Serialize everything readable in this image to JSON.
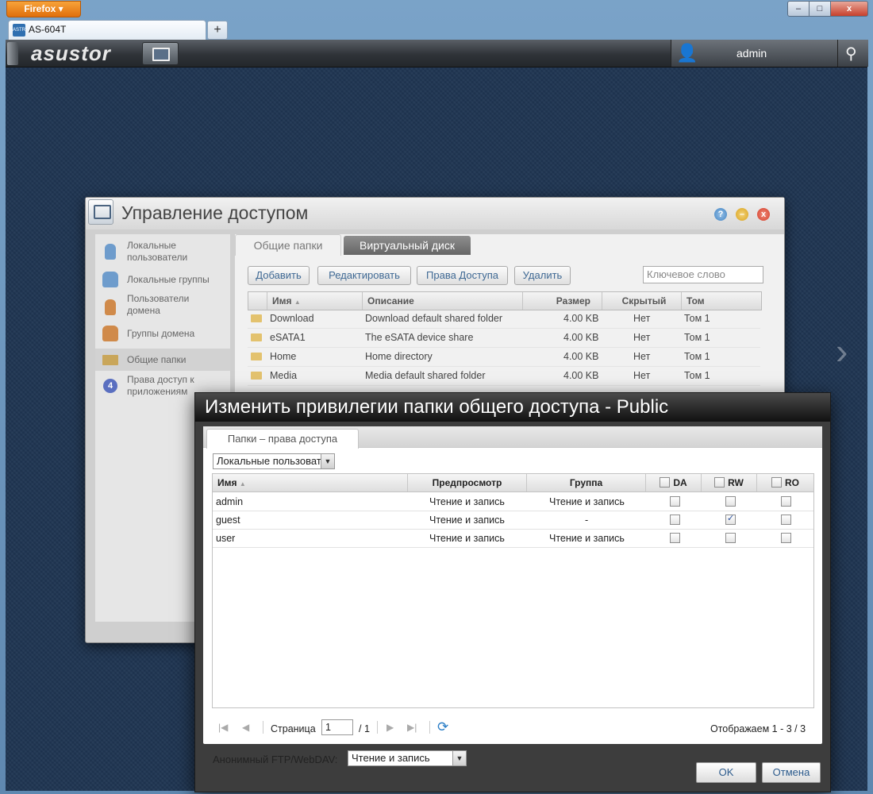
{
  "browser": {
    "menu_label": "Firefox",
    "tab_title": "AS-604T",
    "tab_icon_text": "ASTR",
    "new_tab_label": "+",
    "min_glyph": "–",
    "max_glyph": "□",
    "close_glyph": "x"
  },
  "topbar": {
    "logo": "asustor",
    "user": "admin"
  },
  "access_window": {
    "title": "Управление доступом",
    "help": "?",
    "minimize": "–",
    "close": "x",
    "sidebar": [
      {
        "label": "Локальные пользователи"
      },
      {
        "label": "Локальные группы"
      },
      {
        "label": "Пользователи домена"
      },
      {
        "label": "Группы домена"
      },
      {
        "label": "Общие папки"
      },
      {
        "label": "Права доступ к приложениям"
      }
    ],
    "tabs": [
      "Общие папки",
      "Виртуальный диск"
    ],
    "toolbar": {
      "add": "Добавить",
      "edit": "Редактировать",
      "access": "Права Доступа",
      "delete": "Удалить",
      "search_placeholder": "Ключевое слово"
    },
    "columns": [
      "Имя",
      "Описание",
      "Размер",
      "Скрытый",
      "Том"
    ],
    "rows": [
      {
        "name": "Download",
        "desc": "Download default shared folder",
        "size": "4.00 KB",
        "hidden": "Нет",
        "volume": "Том 1"
      },
      {
        "name": "eSATA1",
        "desc": "The eSATA device share",
        "size": "4.00 KB",
        "hidden": "Нет",
        "volume": "Том 1"
      },
      {
        "name": "Home",
        "desc": "Home directory",
        "size": "4.00 KB",
        "hidden": "Нет",
        "volume": "Том 1"
      },
      {
        "name": "Media",
        "desc": "Media default shared folder",
        "size": "4.00 KB",
        "hidden": "Нет",
        "volume": "Том 1"
      }
    ]
  },
  "dialog": {
    "title": "Изменить привилегии папки общего доступа - Public",
    "tab": "Папки – права доступа",
    "user_type_select": "Локальные пользователи",
    "columns": {
      "name": "Имя",
      "preview": "Предпросмотр",
      "group": "Группа",
      "da": "DA",
      "rw": "RW",
      "ro": "RO"
    },
    "rows": [
      {
        "name": "admin",
        "preview": "Чтение и запись",
        "group": "Чтение и запись",
        "da": false,
        "rw": false,
        "ro": false
      },
      {
        "name": "guest",
        "preview": "Чтение и запись",
        "group": "-",
        "da": false,
        "rw": true,
        "ro": false
      },
      {
        "name": "user",
        "preview": "Чтение и запись",
        "group": "Чтение и запись",
        "da": false,
        "rw": false,
        "ro": false
      }
    ],
    "pager": {
      "page_label": "Страница",
      "page": "1",
      "total": "/ 1",
      "info": "Отображаем 1 - 3 / 3"
    },
    "ftp_label": "Анонимный FTP/WebDAV:",
    "ftp_value": "Чтение и запись",
    "ok": "OK",
    "cancel": "Отмена"
  }
}
